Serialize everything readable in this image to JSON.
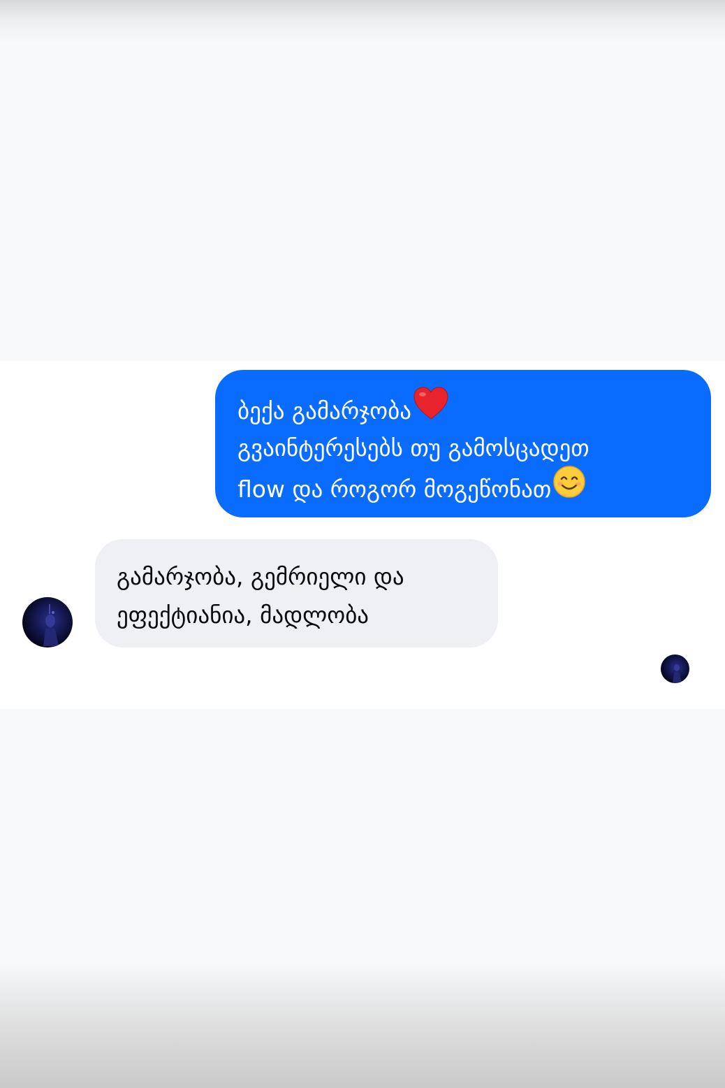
{
  "conversation": {
    "sent_message": {
      "lines": [
        "ბექა გამარჯობა",
        "გვაინტერესებს თუ გამოსცადეთ",
        "flow და როგორ მოგეწონათ"
      ],
      "line1_emoji": "heart-icon",
      "line3_emoji": "smiling-face-icon"
    },
    "received_message": {
      "lines": [
        "გამარჯობა, გემრიელი და",
        "ეფექტიანია, მადლობა"
      ]
    }
  },
  "colors": {
    "sent_bubble": "#0a6cff",
    "received_bubble": "#eff0f4",
    "chat_background": "#ffffff",
    "page_background": "#f7f9fb"
  }
}
